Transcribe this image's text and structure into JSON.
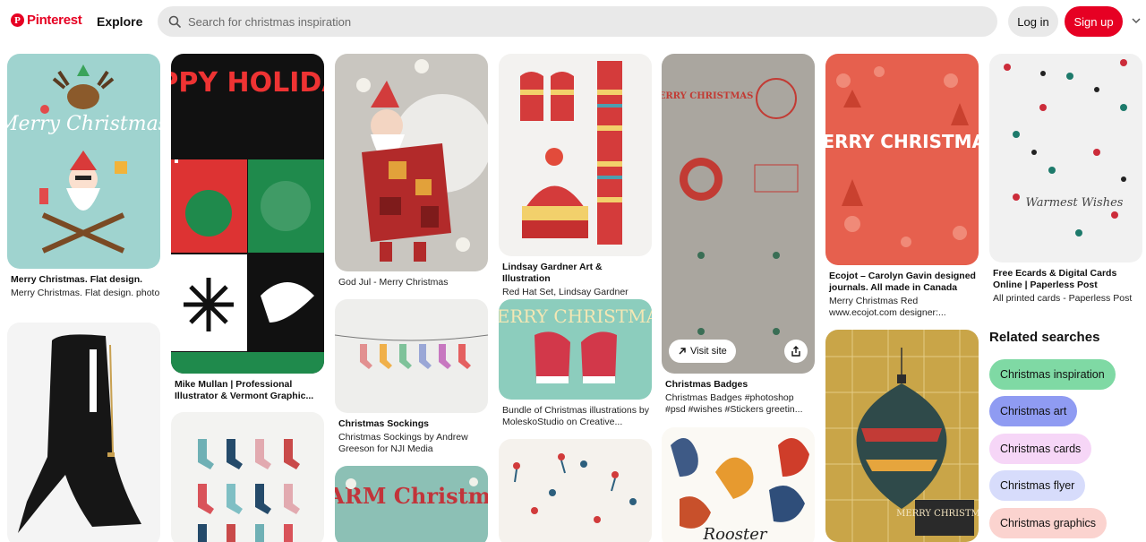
{
  "header": {
    "logo_text": "Pinterest",
    "logo_mark": "P",
    "explore_label": "Explore",
    "search_placeholder": "Search for christmas inspiration",
    "login_label": "Log in",
    "signup_label": "Sign up",
    "icons": {
      "search": "search-icon",
      "chevron": "chevron-down-icon"
    },
    "colors": {
      "brand": "#e60023",
      "search_bg": "#e9e9e9"
    }
  },
  "pins": [
    {
      "title": "Merry Christmas. Flat design.",
      "description": "Merry Christmas. Flat design. photo",
      "image_text": "Merry Christmas"
    },
    {
      "title": "",
      "description": "",
      "image_text": ""
    },
    {
      "title": "Mike Mullan | Professional Illustrator & Vermont Graphic...",
      "description": "",
      "image_text": "HAPPY HOLIDAYS"
    },
    {
      "title": "",
      "description": "",
      "image_text": ""
    },
    {
      "title": "",
      "description": "God Jul - Merry Christmas",
      "image_text": ""
    },
    {
      "title": "Christmas Sockings",
      "description": "Christmas Sockings by Andrew Greeson for NJI Media",
      "image_text": ""
    },
    {
      "title": "",
      "description": "",
      "image_text": "WARM Christmas"
    },
    {
      "title": "Lindsay Gardner Art & Illustration",
      "description": "Red Hat Set, Lindsay Gardner",
      "image_text": ""
    },
    {
      "title": "",
      "description": "Bundle of Christmas illustrations by MoleskoStudio on Creative...",
      "image_text": "MERRY CHRISTMAS"
    },
    {
      "title": "",
      "description": "",
      "image_text": ""
    },
    {
      "title": "Christmas Badges",
      "description": "Christmas Badges #photoshop #psd #wishes #Stickers greetin...",
      "image_text": "MERRY CHRISTMAS"
    },
    {
      "title": "",
      "description": "",
      "image_text": "Rooster"
    },
    {
      "title": "Ecojot – Carolyn Gavin designed journals. All made in Canada",
      "description": "Merry Christmas Red www.ecojot.com designer:...",
      "image_text": "MERRY CHRISTMAS"
    },
    {
      "title": "",
      "description": "",
      "image_text": "MERRY CHRISTMAS"
    },
    {
      "title": "Free Ecards & Digital Cards Online | Paperless Post",
      "description": "All printed cards - Paperless Post",
      "image_text": "Warmest Wishes"
    }
  ],
  "hover_actions": {
    "visit_label": "Visit site",
    "visit_icon": "arrow-up-right-icon",
    "share_icon": "share-icon"
  },
  "related": {
    "title": "Related searches",
    "items": [
      {
        "label": "Christmas inspiration",
        "color": "#7fd9a4"
      },
      {
        "label": "Christmas art",
        "color": "#8f9bf2"
      },
      {
        "label": "Christmas cards",
        "color": "#f6d6f7"
      },
      {
        "label": "Christmas flyer",
        "color": "#d7dcfb"
      },
      {
        "label": "Christmas graphics",
        "color": "#fbd3cf"
      }
    ]
  }
}
